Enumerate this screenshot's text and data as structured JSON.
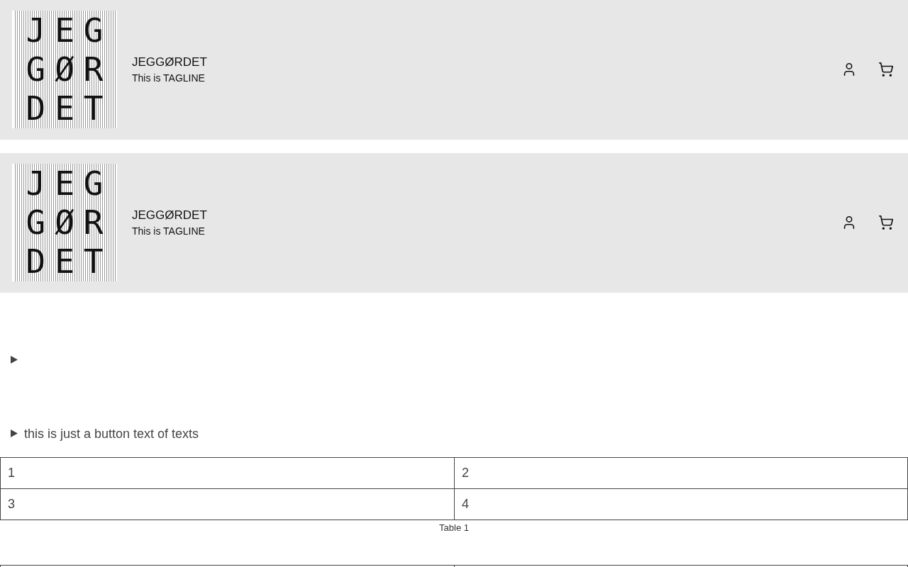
{
  "headers": [
    {
      "logo": {
        "rows": [
          "JEG",
          "GØR",
          "DET"
        ]
      },
      "title": "JEGGØRDET",
      "tagline": "This is TAGLINE"
    },
    {
      "logo": {
        "rows": [
          "JEG",
          "GØR",
          "DET"
        ]
      },
      "title": "JEGGØRDET",
      "tagline": "This is TAGLINE"
    }
  ],
  "disclosures": [
    {
      "expanded": false
    },
    {
      "expanded": false,
      "summary": "this is just a button text of texts"
    }
  ],
  "table": {
    "rows": [
      [
        "1",
        "2"
      ],
      [
        "3",
        "4"
      ]
    ],
    "caption": "Table 1"
  }
}
